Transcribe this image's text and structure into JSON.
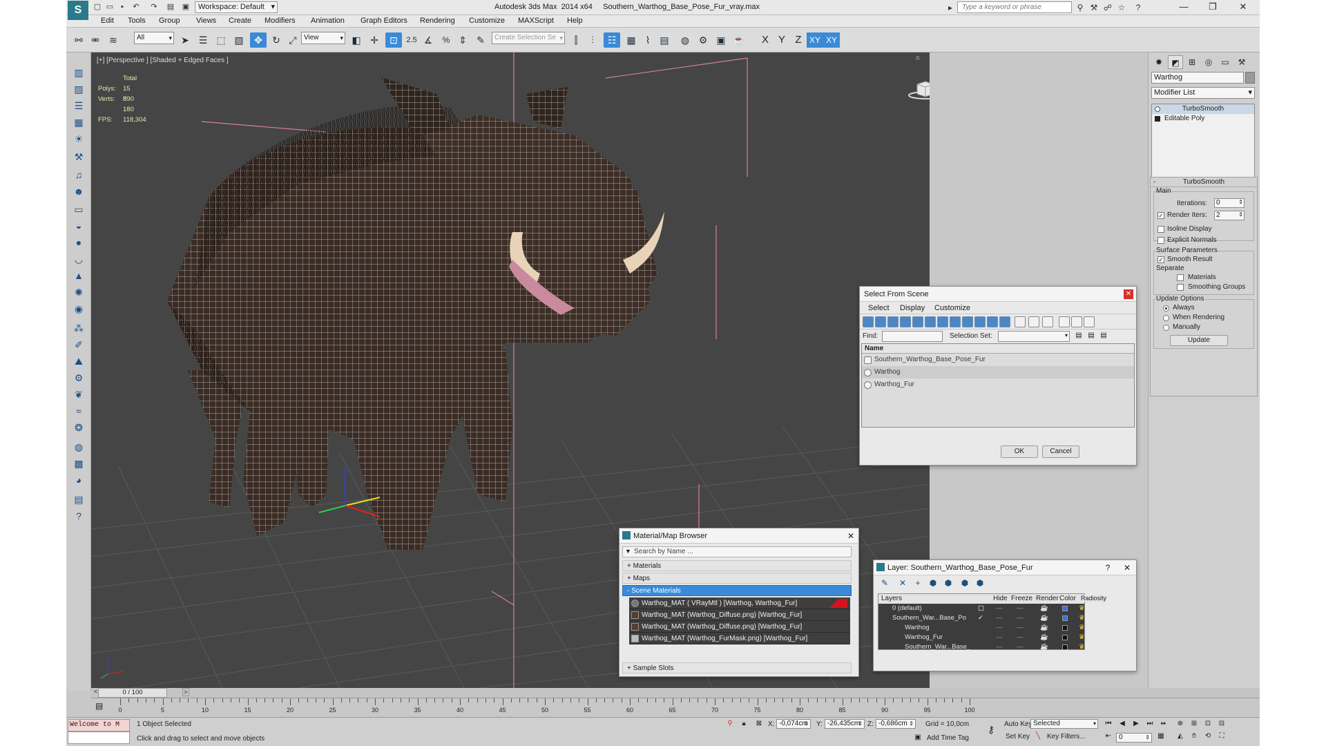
{
  "titlebar": {
    "workspace": "Workspace: Default",
    "title": "Autodesk 3ds Max  2014 x64     Southern_Warthog_Base_Pose_Fur_vray.max",
    "search_placeholder": "Type a keyword or phrase"
  },
  "menus": [
    "Edit",
    "Tools",
    "Group",
    "Views",
    "Create",
    "Modifiers",
    "Animation",
    "Graph Editors",
    "Rendering",
    "Customize",
    "MAXScript",
    "Help"
  ],
  "toolbar": {
    "filter": "All",
    "refcoord": "View",
    "snap_angle": "2.5",
    "selection_set_placeholder": "Create Selection Se",
    "axes": [
      "X",
      "Y",
      "Z",
      "XY",
      "XY"
    ]
  },
  "viewport": {
    "label": "[+] [Perspective ] [Shaded + Edged Faces ]",
    "stats": {
      "total_label": "Total",
      "polys_label": "Polys:",
      "polys": "15 890",
      "verts_label": "Verts:",
      "verts": "8 180",
      "fps_label": "FPS:",
      "fps": "118,304"
    }
  },
  "command_panel": {
    "object_name": "Warthog",
    "modifier_list": "Modifier List",
    "stack": [
      "TurboSmooth",
      "Editable Poly"
    ],
    "rollout_title": "TurboSmooth",
    "main_label": "Main",
    "iterations_label": "Iterations:",
    "iterations": "0",
    "render_iters_label": "Render Iters:",
    "render_iters": "2",
    "isoline": "Isoline Display",
    "explicit": "Explicit Normals",
    "surface_params": "Surface Parameters",
    "smooth_result": "Smooth Result",
    "separate": "Separate",
    "materials": "Materials",
    "smoothing_groups": "Smoothing Groups",
    "update_options": "Update Options",
    "always": "Always",
    "when_rendering": "When Rendering",
    "manually": "Manually",
    "update_btn": "Update"
  },
  "select_from_scene": {
    "title": "Select From Scene",
    "menus": [
      "Select",
      "Display",
      "Customize"
    ],
    "find_label": "Find:",
    "selection_set_label": "Selection Set:",
    "name_header": "Name",
    "items": [
      "Southern_Warthog_Base_Pose_Fur",
      "Warthog",
      "Warthog_Fur"
    ],
    "ok": "OK",
    "cancel": "Cancel"
  },
  "material_browser": {
    "title": "Material/Map Browser",
    "search_placeholder": "Search by Name ...",
    "materials": "+ Materials",
    "maps": "+ Maps",
    "scene_materials": "- Scene Materials",
    "items": [
      "Warthog_MAT  ( VRayMtl )  [Warthog, Warthog_Fur]",
      "Warthog_MAT (Warthog_Diffuse.png) [Warthog_Fur]",
      "Warthog_MAT (Warthog_Diffuse.png) [Warthog_Fur]",
      "Warthog_MAT (Warthog_FurMask.png) [Warthog_Fur]"
    ],
    "sample_slots": "+ Sample Slots"
  },
  "layer_dialog": {
    "title": "Layer: Southern_Warthog_Base_Pose_Fur",
    "help": "?",
    "headers": [
      "Layers",
      "Hide",
      "Freeze",
      "Render",
      "Color",
      "Radiosity"
    ],
    "rows": [
      "0 (default)",
      "Southern_War...Base_Po",
      "Warthog",
      "Warthog_Fur",
      "Southern_War...Base_"
    ]
  },
  "timeline": {
    "slider": "0 / 100",
    "ticks": [
      "0",
      "5",
      "10",
      "15",
      "20",
      "25",
      "30",
      "35",
      "40",
      "45",
      "50",
      "55",
      "60",
      "65",
      "70",
      "75",
      "80",
      "85",
      "90",
      "95",
      "100"
    ]
  },
  "status": {
    "maxscript": "Welcome to M",
    "selected": "1 Object Selected",
    "prompt": "Click and drag to select and move objects",
    "x_label": "X:",
    "x": "-0,074cm",
    "y_label": "Y:",
    "y": "-26,435cm",
    "z_label": "Z:",
    "z": "-0,686cm",
    "grid": "Grid = 10,0cm",
    "auto_key": "Auto Key",
    "key_mode": "Selected",
    "set_key": "Set Key",
    "key_filters": "Key Filters...",
    "add_time_tag": "Add Time Tag",
    "frame": "0"
  }
}
